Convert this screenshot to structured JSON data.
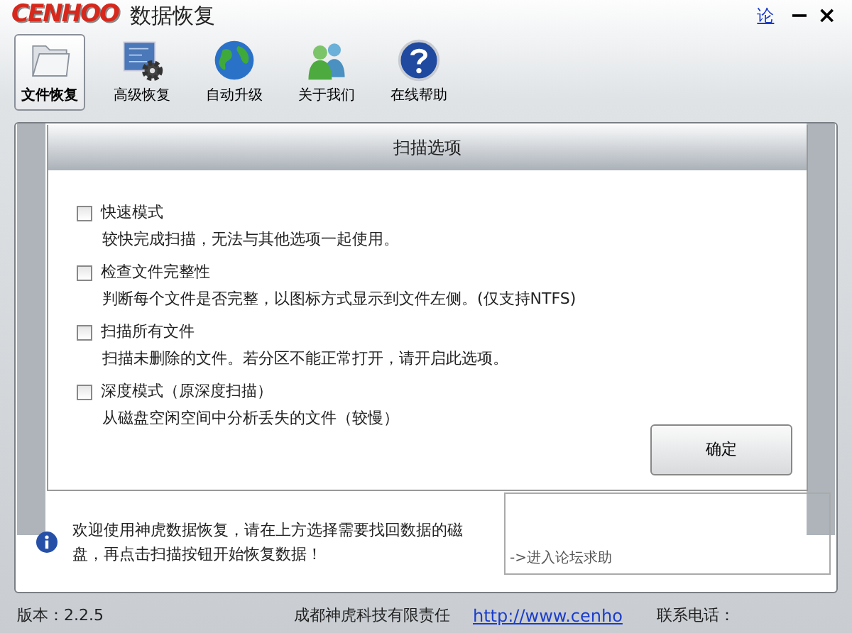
{
  "window": {
    "logo": "CENHOO",
    "title": "数据恢复",
    "forum_link": "论",
    "minimize": "−",
    "close": "×"
  },
  "toolbar": [
    {
      "label": "文件恢复",
      "kind": "folder",
      "selected": true
    },
    {
      "label": "高级恢复",
      "kind": "gear",
      "selected": false
    },
    {
      "label": "自动升级",
      "kind": "globe",
      "selected": false
    },
    {
      "label": "关于我们",
      "kind": "people",
      "selected": false
    },
    {
      "label": "在线帮助",
      "kind": "help",
      "selected": false
    }
  ],
  "dialog": {
    "title": "扫描选项",
    "options": [
      {
        "label": "快速模式",
        "description": "较快完成扫描，无法与其他选项一起使用。",
        "checked": false
      },
      {
        "label": "检查文件完整性",
        "description": "判断每个文件是否完整，以图标方式显示到文件左侧。(仅支持NTFS)",
        "checked": false
      },
      {
        "label": "扫描所有文件",
        "description": "扫描未删除的文件。若分区不能正常打开，请开启此选项。",
        "checked": false
      },
      {
        "label": "深度模式（原深度扫描）",
        "description": "从磁盘空闲空间中分析丢失的文件（较慢）",
        "checked": false
      }
    ],
    "ok_button": "确定"
  },
  "info": {
    "message": "欢迎使用神虎数据恢复，请在上方选择需要找回数据的磁盘，再点击扫描按钮开始恢复数据！",
    "forum_help": "->进入论坛求助"
  },
  "status_bar": {
    "version": "版本：2.2.5",
    "company": "成都神虎科技有限责任",
    "website": "http://www.cenho",
    "phone": "联系电话："
  }
}
